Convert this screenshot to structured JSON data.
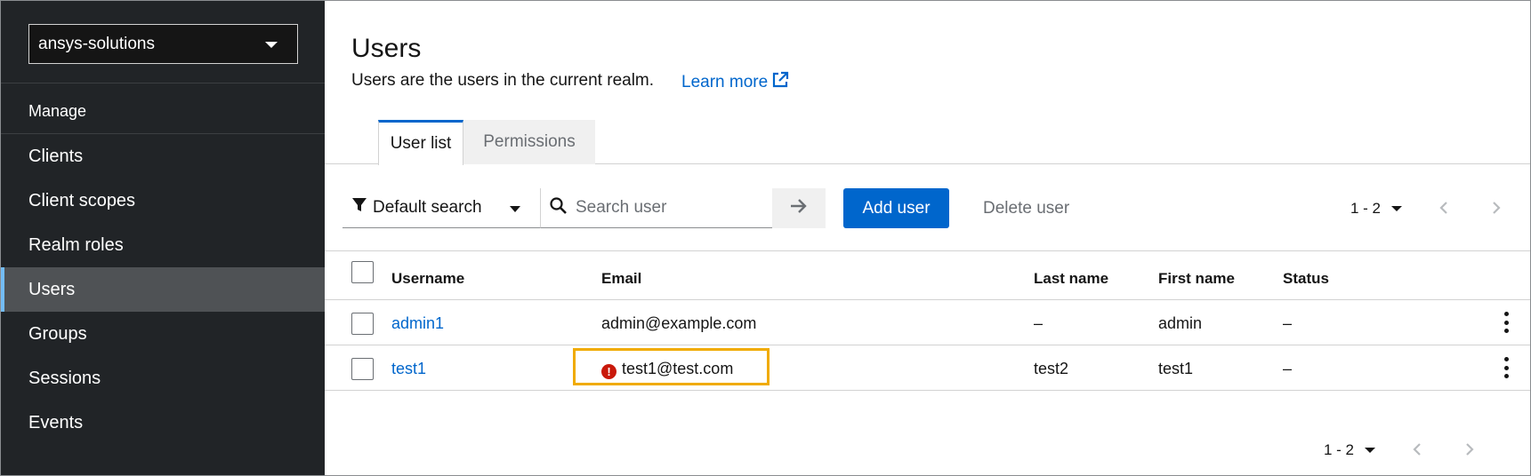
{
  "sidebar": {
    "realm": "ansys-solutions",
    "section_title": "Manage",
    "items": [
      {
        "label": "Clients"
      },
      {
        "label": "Client scopes"
      },
      {
        "label": "Realm roles"
      },
      {
        "label": "Users"
      },
      {
        "label": "Groups"
      },
      {
        "label": "Sessions"
      },
      {
        "label": "Events"
      }
    ],
    "active_item": "Users"
  },
  "header": {
    "title": "Users",
    "description": "Users are the users in the current realm.",
    "learn_more": "Learn more"
  },
  "tabs": [
    {
      "label": "User list",
      "active": true
    },
    {
      "label": "Permissions",
      "active": false
    }
  ],
  "toolbar": {
    "filter_label": "Default search",
    "search_placeholder": "Search user",
    "add_user": "Add user",
    "delete_user": "Delete user",
    "pagination": "1 - 2"
  },
  "table": {
    "columns": [
      "Username",
      "Email",
      "Last name",
      "First name",
      "Status"
    ],
    "rows": [
      {
        "username": "admin1",
        "email": "admin@example.com",
        "last_name": "–",
        "first_name": "admin",
        "status": "–"
      },
      {
        "username": "test1",
        "email": "test1@test.com",
        "last_name": "test2",
        "first_name": "test1",
        "status": "–",
        "email_warning": true
      }
    ]
  },
  "footer": {
    "pagination": "1 - 2"
  },
  "colors": {
    "accent": "#0066cc",
    "sidebar_bg": "#212427",
    "active_nav": "#4f5255",
    "highlight": "#f0ab00",
    "error": "#c9190b"
  }
}
